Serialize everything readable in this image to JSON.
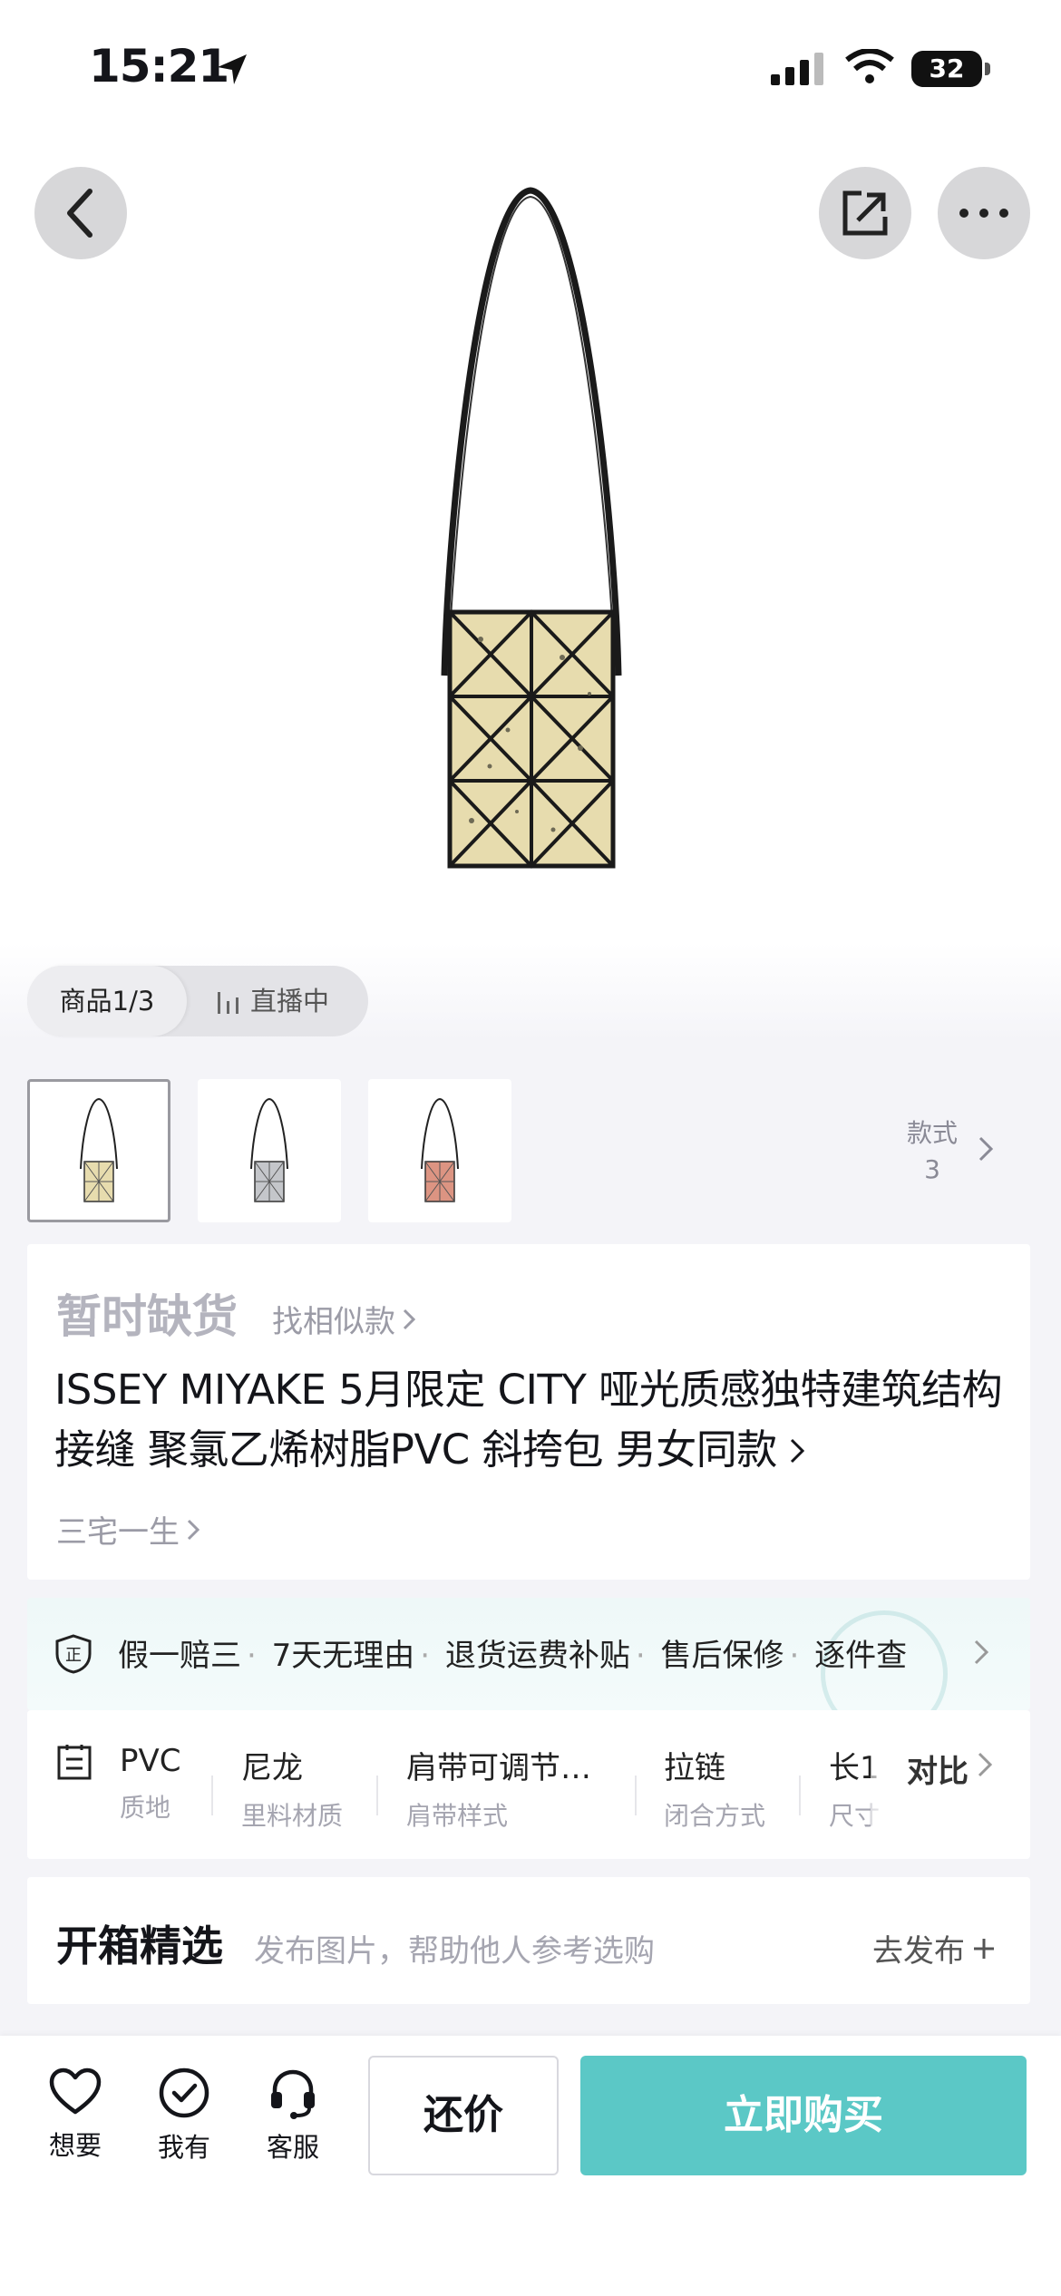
{
  "status_bar": {
    "time": "15:21",
    "battery": "32"
  },
  "gallery": {
    "counter": "商品1/3",
    "live_label": "直播中",
    "style_label": "款式",
    "style_count": "3"
  },
  "product": {
    "stock_status": "暂时缺货",
    "find_similar": "找相似款",
    "title": "ISSEY MIYAKE 5月限定 CITY 哑光质感独特建筑结构接缝 聚氯乙烯树脂PVC 斜挎包 男女同款",
    "brand": "三宅一生"
  },
  "guarantee": {
    "items": [
      "假一赔三",
      "7天无理由",
      "退货运费补贴",
      "售后保修",
      "逐件查"
    ]
  },
  "specs": {
    "items": [
      {
        "value": "PVC",
        "key": "质地"
      },
      {
        "value": "尼龙",
        "key": "里料材质"
      },
      {
        "value": "肩带可调节…",
        "key": "肩带样式"
      },
      {
        "value": "拉链",
        "key": "闭合方式"
      },
      {
        "value": "长1",
        "key": "尺寸"
      }
    ],
    "compare": "对比"
  },
  "unbox": {
    "title": "开箱精选",
    "subtitle": "发布图片，帮助他人参考选购",
    "post": "去发布"
  },
  "bottom": {
    "want": "想要",
    "have": "我有",
    "service": "客服",
    "bargain": "还价",
    "buy": "立即购买"
  },
  "colors": {
    "accent": "#5bc8c6",
    "bag_yellow": "#e7dcae",
    "bag_grey": "#c4c6ca",
    "bag_pink": "#dc9482"
  }
}
